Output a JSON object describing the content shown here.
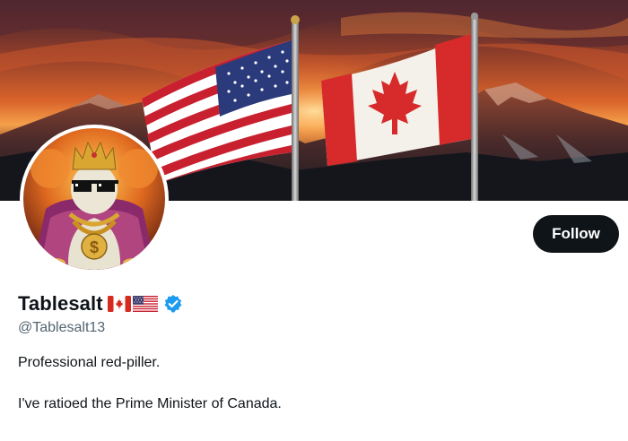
{
  "profile": {
    "display_name": "Tablesalt",
    "handle": "@Tablesalt13",
    "name_flags": [
      "canada-flag-icon",
      "usa-flag-icon"
    ],
    "verified": true,
    "bio": [
      "Professional red-piller.",
      "I've ratioed the Prime Minister of Canada."
    ]
  },
  "actions": {
    "follow_label": "Follow"
  },
  "colors": {
    "text_primary": "#0f1419",
    "text_secondary": "#536471",
    "button_bg": "#0f1419",
    "button_text": "#ffffff",
    "verified_blue": "#1d9bf0"
  }
}
